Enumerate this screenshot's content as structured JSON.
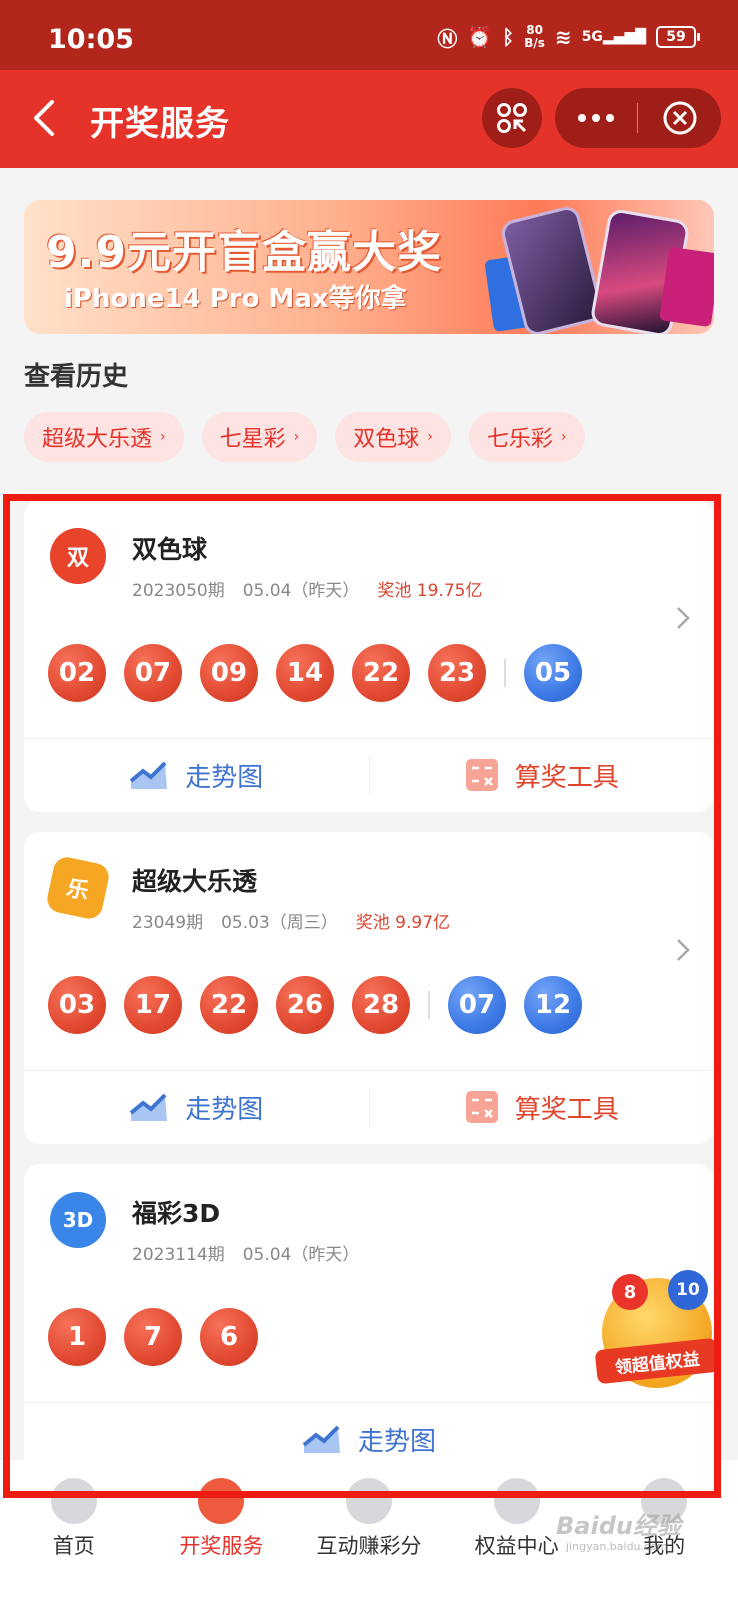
{
  "status_bar": {
    "time": "10:05",
    "speed_value": "80",
    "speed_unit": "B/s",
    "network": "5G",
    "battery": "59"
  },
  "nav": {
    "title": "开奖服务"
  },
  "banner": {
    "title": "9.9元开盲盒赢大奖",
    "subtitle": "iPhone14 Pro Max等你拿"
  },
  "history": {
    "title": "查看历史",
    "chips": [
      "超级大乐透",
      "七星彩",
      "双色球",
      "七乐彩"
    ]
  },
  "cards": [
    {
      "name": "双色球",
      "icon_text": "双",
      "icon_color": "#e8432b",
      "period": "2023050期",
      "date": "05.04（昨天）",
      "pool": "奖池 19.75亿",
      "red_balls": [
        "02",
        "07",
        "09",
        "14",
        "22",
        "23"
      ],
      "blue_balls": [
        "05"
      ],
      "trend_label": "走势图",
      "tool_label": "算奖工具"
    },
    {
      "name": "超级大乐透",
      "icon_text": "乐",
      "icon_color": "#f5a623",
      "period": "23049期",
      "date": "05.03（周三）",
      "pool": "奖池 9.97亿",
      "red_balls": [
        "03",
        "17",
        "22",
        "26",
        "28"
      ],
      "blue_balls": [
        "07",
        "12"
      ],
      "trend_label": "走势图",
      "tool_label": "算奖工具"
    },
    {
      "name": "福彩3D",
      "icon_text": "3D",
      "icon_color": "#3a86e8",
      "period": "2023114期",
      "date": "05.04（昨天）",
      "red_balls": [
        "1",
        "7",
        "6"
      ],
      "trend_label": "走势图"
    }
  ],
  "float_promo": {
    "label": "领超值权益",
    "ball_1": "8",
    "ball_2": "10"
  },
  "tabs": [
    {
      "label": "首页",
      "active": false
    },
    {
      "label": "开奖服务",
      "active": true
    },
    {
      "label": "互动赚彩分",
      "active": false
    },
    {
      "label": "权益中心",
      "active": false
    },
    {
      "label": "我的",
      "active": false
    }
  ],
  "watermark": {
    "brand": "Baidu经验",
    "url": "jingyan.baidu.com"
  },
  "colors": {
    "nav_red": "#e5332a",
    "status_red": "#b2261c",
    "ball_red": "#e24a32",
    "ball_blue": "#3d7ae6",
    "frame_red": "#ef1c14"
  }
}
